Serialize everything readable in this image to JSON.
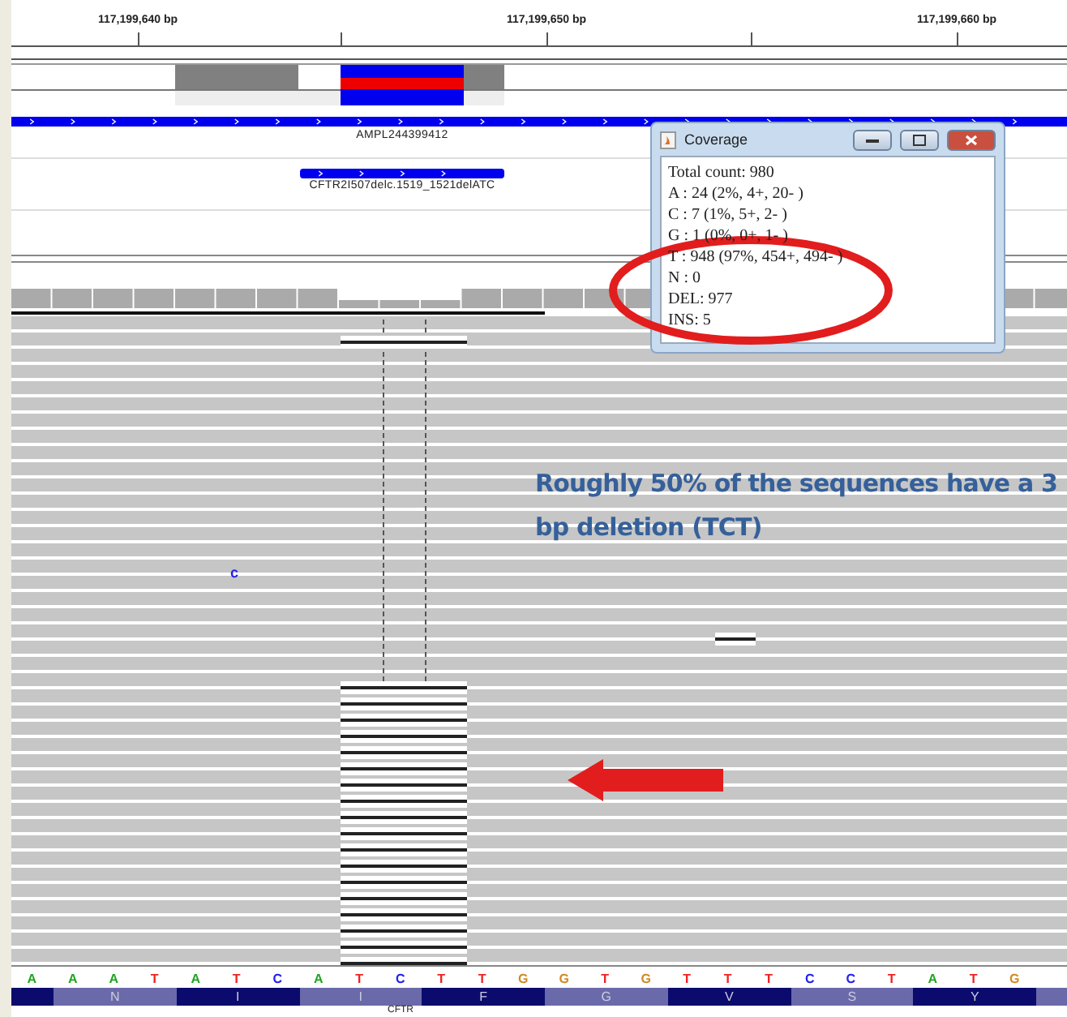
{
  "ruler": {
    "labels": [
      "117,199,640 bp",
      "117,199,650 bp",
      "117,199,660 bp"
    ]
  },
  "features": [
    {
      "label": "AMPL244399412"
    },
    {
      "label": "CFTR2I507delc.1519_1521delATC"
    }
  ],
  "mismatch_base": "c",
  "sequence": [
    {
      "base": "A",
      "color": "#1fa51f"
    },
    {
      "base": "A",
      "color": "#1fa51f"
    },
    {
      "base": "A",
      "color": "#1fa51f"
    },
    {
      "base": "T",
      "color": "#ee2222"
    },
    {
      "base": "A",
      "color": "#1fa51f"
    },
    {
      "base": "T",
      "color": "#ee2222"
    },
    {
      "base": "C",
      "color": "#2222ee"
    },
    {
      "base": "A",
      "color": "#1fa51f"
    },
    {
      "base": "T",
      "color": "#ee2222"
    },
    {
      "base": "C",
      "color": "#2222ee"
    },
    {
      "base": "T",
      "color": "#ee2222"
    },
    {
      "base": "T",
      "color": "#ee2222"
    },
    {
      "base": "G",
      "color": "#d18a2a"
    },
    {
      "base": "G",
      "color": "#d18a2a"
    },
    {
      "base": "T",
      "color": "#ee2222"
    },
    {
      "base": "G",
      "color": "#d18a2a"
    },
    {
      "base": "T",
      "color": "#ee2222"
    },
    {
      "base": "T",
      "color": "#ee2222"
    },
    {
      "base": "T",
      "color": "#ee2222"
    },
    {
      "base": "C",
      "color": "#2222ee"
    },
    {
      "base": "C",
      "color": "#2222ee"
    },
    {
      "base": "T",
      "color": "#ee2222"
    },
    {
      "base": "A",
      "color": "#1fa51f"
    },
    {
      "base": "T",
      "color": "#ee2222"
    },
    {
      "base": "G",
      "color": "#d18a2a"
    }
  ],
  "translation": [
    {
      "aa": "N",
      "color": "#6a6aaa"
    },
    {
      "aa": "I",
      "color": "#0b0b6e"
    },
    {
      "aa": "I",
      "color": "#6a6aaa"
    },
    {
      "aa": "F",
      "color": "#0b0b6e"
    },
    {
      "aa": "G",
      "color": "#6a6aaa"
    },
    {
      "aa": "V",
      "color": "#0b0b6e"
    },
    {
      "aa": "S",
      "color": "#6a6aaa"
    },
    {
      "aa": "Y",
      "color": "#0b0b6e"
    }
  ],
  "gene_label": "CFTR",
  "coverage_popup": {
    "title": "Coverage",
    "lines": [
      "Total count: 980",
      "A : 24 (2%, 4+, 20- )",
      "C : 7 (1%, 5+, 2- )",
      "G : 1 (0%, 0+, 1- )",
      "T : 948 (97%, 454+, 494- )",
      "N : 0",
      "DEL: 977",
      "INS: 5"
    ]
  },
  "annotation": {
    "lines": [
      "Roughly 50% of the sequences have a 3",
      "bp deletion (TCT)"
    ]
  }
}
